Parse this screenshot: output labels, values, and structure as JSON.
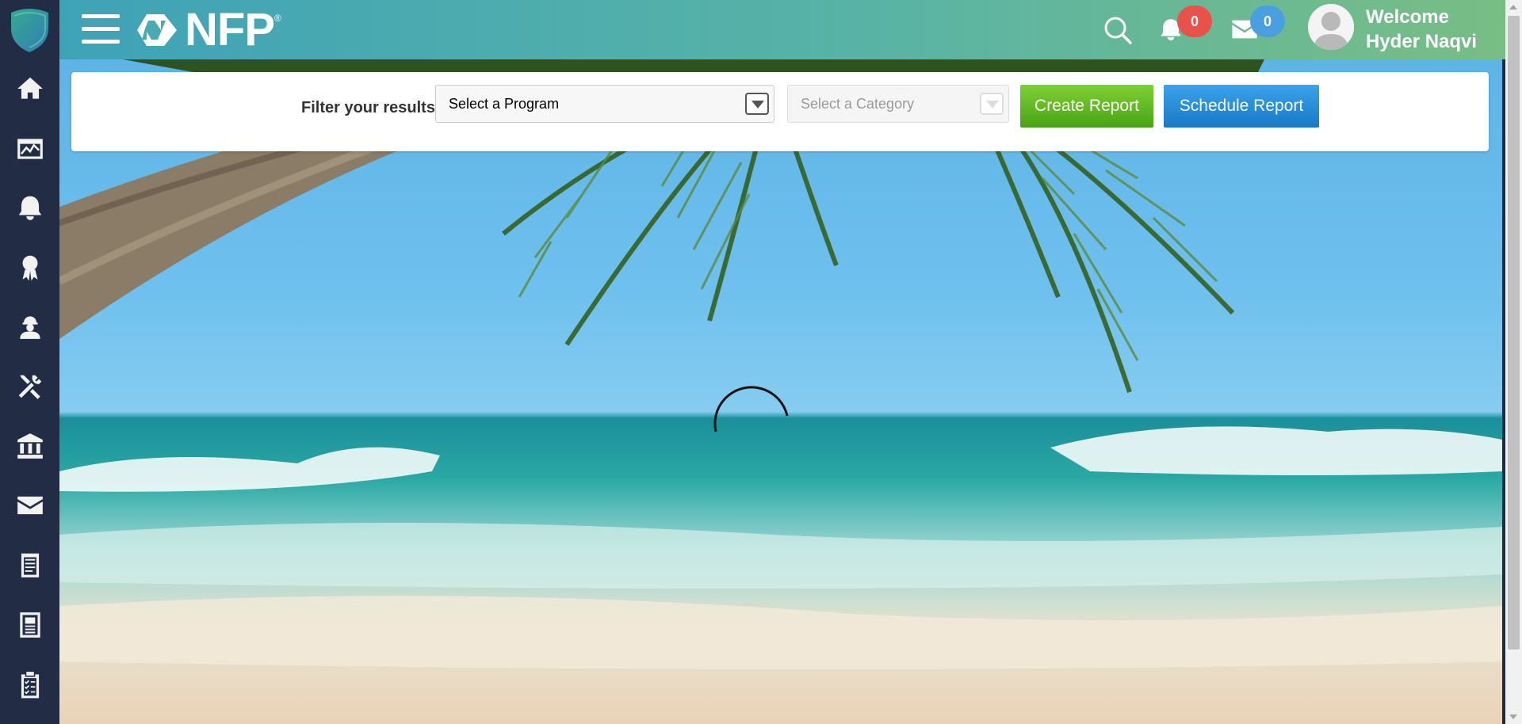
{
  "brand": {
    "name": "NFP",
    "reg": "®"
  },
  "header": {
    "notifications_count": "0",
    "messages_count": "0",
    "welcome_line1": "Welcome",
    "welcome_line2": "Hyder Naqvi"
  },
  "sidebar": {
    "items": [
      {
        "icon": "home-icon"
      },
      {
        "icon": "dashboard-chart-icon"
      },
      {
        "icon": "alerts-bell-icon"
      },
      {
        "icon": "award-ribbon-icon"
      },
      {
        "icon": "worker-icon"
      },
      {
        "icon": "tools-icon"
      },
      {
        "icon": "bank-icon"
      },
      {
        "icon": "mail-icon"
      },
      {
        "icon": "notepad-icon"
      },
      {
        "icon": "document-icon"
      },
      {
        "icon": "clipboard-checklist-icon"
      }
    ]
  },
  "filter": {
    "label": "Filter your results",
    "program_placeholder": "Select a Program",
    "category_placeholder": "Select a Category",
    "create_label": "Create Report",
    "schedule_label": "Schedule Report"
  },
  "colors": {
    "sidebar_bg": "#232c45",
    "header_start": "#3fa3b7",
    "header_end": "#78bd85",
    "badge_red": "#e8524a",
    "badge_blue": "#4a9fe0",
    "create_green": "#5ab320",
    "schedule_blue": "#2589d6"
  }
}
